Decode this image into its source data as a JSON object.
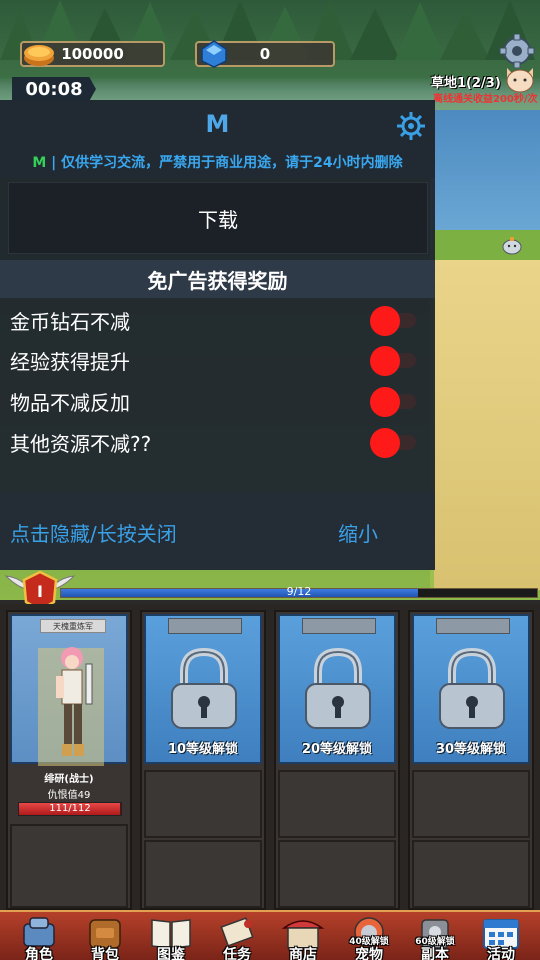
{
  "topbar": {
    "gold": "100000",
    "gems": "0"
  },
  "timer": "00:08",
  "stage": {
    "name": "草地1(2/3)",
    "offline_text": "离线通关收益200秒/次"
  },
  "menu": {
    "title": "M",
    "notice_prefix": "M",
    "notice": "| 仅供学习交流，严禁用于商业用途，请于24小时内删除",
    "download_label": "下载",
    "section_title": "免广告获得奖励",
    "options": [
      {
        "label": "金币钻石不减",
        "enabled": true
      },
      {
        "label": "经验获得提升",
        "enabled": true
      },
      {
        "label": "物品不减反加",
        "enabled": true
      },
      {
        "label": "其他资源不减??",
        "enabled": true
      }
    ],
    "hide_label": "点击隐藏/长按关闭",
    "minimize_label": "缩小",
    "colors": {
      "accent": "#3aa0e6",
      "toggle_on": "#ff1a1a",
      "notice_m": "#34d058"
    }
  },
  "level": {
    "badge_text": "I",
    "progress_text": "9/12",
    "progress": 0.75
  },
  "hero": {
    "title_plate": "天槐重炼军",
    "name": "绯研(战士)",
    "hate": "仇恨值49",
    "hp_text": "111/112",
    "hp": 0.99
  },
  "locked_slots": [
    {
      "label": "10等级解锁"
    },
    {
      "label": "20等级解锁"
    },
    {
      "label": "30等级解锁"
    }
  ],
  "nav": [
    {
      "label": "角色",
      "icon": "character-icon"
    },
    {
      "label": "背包",
      "icon": "backpack-icon"
    },
    {
      "label": "图鉴",
      "icon": "book-icon"
    },
    {
      "label": "任务",
      "icon": "scroll-icon"
    },
    {
      "label": "商店",
      "icon": "shop-icon"
    },
    {
      "label": "宠物",
      "icon": "pet-icon",
      "overlay": "40级解锁"
    },
    {
      "label": "副本",
      "icon": "dungeon-icon",
      "overlay": "60级解锁"
    },
    {
      "label": "活动",
      "icon": "calendar-icon"
    }
  ]
}
